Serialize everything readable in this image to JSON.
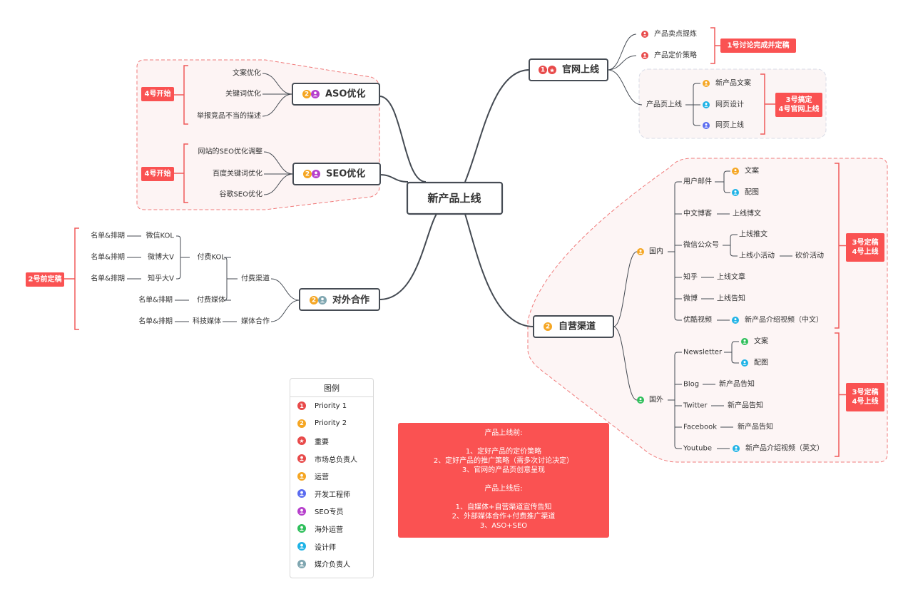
{
  "colors": {
    "red": "#e84a4a",
    "orange": "#f5a623",
    "purple": "#b63fcc",
    "blue": "#5b6cf0",
    "green": "#2fbf5b",
    "cyan": "#1fb3e6",
    "teal": "#7fa6b0",
    "note": "#fa5252",
    "line": "#444a52",
    "boundary": "#f07a7a"
  },
  "root": {
    "label": "新产品上线"
  },
  "branches": {
    "official": {
      "label": "官网上线",
      "markers": [
        "priority-1",
        "star"
      ],
      "children": [
        {
          "label": "产品卖点提炼",
          "marker": "person-red"
        },
        {
          "label": "产品定价策略",
          "marker": "person-red"
        },
        {
          "label": "产品页上线",
          "children": [
            {
              "label": "新产品文案",
              "marker": "person-orange"
            },
            {
              "label": "网页设计",
              "marker": "person-cyan"
            },
            {
              "label": "网页上线",
              "marker": "person-blue"
            }
          ]
        }
      ],
      "notes": [
        "1号讨论完成并定稿",
        "3号搞定\n4号官网上线"
      ]
    },
    "aso": {
      "label": "ASO优化",
      "markers": [
        "priority-2",
        "person-purple"
      ],
      "children": [
        "文案优化",
        "关键词优化",
        "举报竞品不当的描述"
      ],
      "note": "4号开始"
    },
    "seo": {
      "label": "SEO优化",
      "markers": [
        "priority-2",
        "person-purple"
      ],
      "children": [
        "网站的SEO优化调整",
        "百度关键词优化",
        "谷歌SEO优化"
      ],
      "note": "4号开始"
    },
    "partner": {
      "label": "对外合作",
      "markers": [
        "priority-2",
        "person-teal"
      ],
      "paid_channel": "付费渠道",
      "paid_kol": "付费KOL",
      "kol_items": [
        "微信KOL",
        "微博大V",
        "知乎大V"
      ],
      "paid_media": "付费媒体",
      "media_coop": "媒体合作",
      "tech_media": "科技媒体",
      "schedule": "名单&排期",
      "note": "2号前定稿"
    },
    "self": {
      "label": "自营渠道",
      "markers": [
        "priority-2"
      ],
      "domestic": {
        "label": "国内",
        "marker": "person-orange",
        "email": {
          "label": "用户邮件",
          "items": [
            {
              "label": "文案",
              "marker": "person-orange"
            },
            {
              "label": "配图",
              "marker": "person-cyan"
            }
          ]
        },
        "blog": {
          "label": "中文博客",
          "item": "上线博文"
        },
        "wechat": {
          "label": "微信公众号",
          "items": [
            "上线推文",
            "上线小活动"
          ],
          "sub": "砍价活动"
        },
        "zhihu": {
          "label": "知乎",
          "item": "上线文章"
        },
        "weibo": {
          "label": "微博",
          "item": "上线告知"
        },
        "youku": {
          "label": "优酷视频",
          "item": "新产品介绍视频（中文）",
          "marker": "person-cyan"
        },
        "note": "3号定稿\n4号上线"
      },
      "overseas": {
        "label": "国外",
        "marker": "person-green",
        "newsletter": {
          "label": "Newsletter",
          "items": [
            {
              "label": "文案",
              "marker": "person-green"
            },
            {
              "label": "配图",
              "marker": "person-cyan"
            }
          ]
        },
        "blog": {
          "label": "Blog",
          "item": "新产品告知"
        },
        "twitter": {
          "label": "Twitter",
          "item": "新产品告知"
        },
        "facebook": {
          "label": "Facebook",
          "item": "新产品告知"
        },
        "youtube": {
          "label": "Youtube",
          "item": "新产品介绍视频（英文）",
          "marker": "person-cyan"
        },
        "note": "3号定稿\n4号上线"
      }
    }
  },
  "legend": {
    "title": "图例",
    "items": [
      {
        "icon": "priority-1",
        "glyph": "1",
        "color": "#e84a4a",
        "label": "Priority 1"
      },
      {
        "icon": "priority-2",
        "glyph": "2",
        "color": "#f5a623",
        "label": "Priority 2"
      },
      {
        "icon": "star",
        "glyph": "★",
        "color": "#e84a4a",
        "label": "重要"
      },
      {
        "icon": "person",
        "glyph": "●",
        "color": "#e84a4a",
        "label": "市场总负责人"
      },
      {
        "icon": "person",
        "glyph": "●",
        "color": "#f5a623",
        "label": "运营"
      },
      {
        "icon": "person",
        "glyph": "●",
        "color": "#5b6cf0",
        "label": "开发工程师"
      },
      {
        "icon": "person",
        "glyph": "●",
        "color": "#b63fcc",
        "label": "SEO专员"
      },
      {
        "icon": "person",
        "glyph": "●",
        "color": "#2fbf5b",
        "label": "海外运营"
      },
      {
        "icon": "person",
        "glyph": "●",
        "color": "#1fb3e6",
        "label": "设计师"
      },
      {
        "icon": "person",
        "glyph": "●",
        "color": "#7fa6b0",
        "label": "媒介负责人"
      }
    ]
  },
  "summary": {
    "before_title": "产品上线前:",
    "before": [
      "1、定好产品的定价策略",
      "2、定好产品的推广策略（需多次讨论决定）",
      "3、官网的产品页创意呈现"
    ],
    "after_title": "产品上线后:",
    "after": [
      "1、自媒体+自营渠道宣传告知",
      "2、外部媒体合作+付费推广渠道",
      "3、ASO+SEO"
    ]
  }
}
